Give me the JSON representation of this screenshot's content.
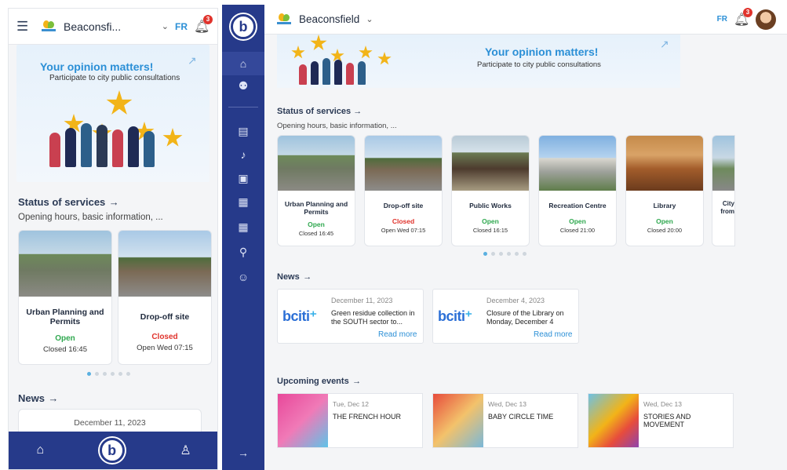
{
  "mobile": {
    "city": "Beaconsfi...",
    "lang": "FR",
    "notif_count": "3",
    "banner_title": "Your opinion matters!",
    "banner_subtitle": "Participate to city public consultations",
    "services_title": "Status of services",
    "services_subtitle": "Opening hours, basic information, ...",
    "services": [
      {
        "name": "Urban Planning and Permits",
        "status": "Open",
        "time": "Closed 16:45"
      },
      {
        "name": "Drop-off site",
        "status": "Closed",
        "time": "Open Wed 07:15"
      }
    ],
    "news_title": "News",
    "news_date": "December 11, 2023"
  },
  "desktop": {
    "city": "Beaconsfield",
    "lang": "FR",
    "notif_count": "3",
    "banner_title": "Your opinion matters!",
    "banner_subtitle": "Participate to city public consultations",
    "services_title": "Status of services",
    "services_subtitle": "Opening hours, basic information, ...",
    "services": [
      {
        "name": "Urban Planning and Permits",
        "status": "Open",
        "time": "Closed 16:45"
      },
      {
        "name": "Drop-off site",
        "status": "Closed",
        "time": "Open Wed 07:15"
      },
      {
        "name": "Public Works",
        "status": "Open",
        "time": "Closed 16:15"
      },
      {
        "name": "Recreation Centre",
        "status": "Open",
        "time": "Closed 21:00"
      },
      {
        "name": "Library",
        "status": "Open",
        "time": "Closed 20:00"
      },
      {
        "name": "City from",
        "status": "",
        "time": ""
      }
    ],
    "news_title": "News",
    "news": [
      {
        "date": "December 11, 2023",
        "text": "Green residue collection in the SOUTH sector to...",
        "read_more": "Read more"
      },
      {
        "date": "December 4, 2023",
        "text": "Closure of the Library on Monday, December 4",
        "read_more": "Read more"
      }
    ],
    "events_title": "Upcoming events",
    "events": [
      {
        "date": "Tue, Dec 12",
        "title": "THE FRENCH HOUR"
      },
      {
        "date": "Wed, Dec 13",
        "title": "BABY CIRCLE TIME"
      },
      {
        "date": "Wed, Dec 13",
        "title": "STORIES AND MOVEMENT"
      }
    ]
  },
  "icons": [
    "menu-icon",
    "chevron-down-icon",
    "bell-icon",
    "home-icon",
    "user-icon",
    "external-link-icon",
    "arrow-right-icon"
  ],
  "colors": {
    "brand": "#263a8a",
    "accent": "#2b8fd6",
    "open": "#2fa84f",
    "closed": "#e0332c"
  }
}
